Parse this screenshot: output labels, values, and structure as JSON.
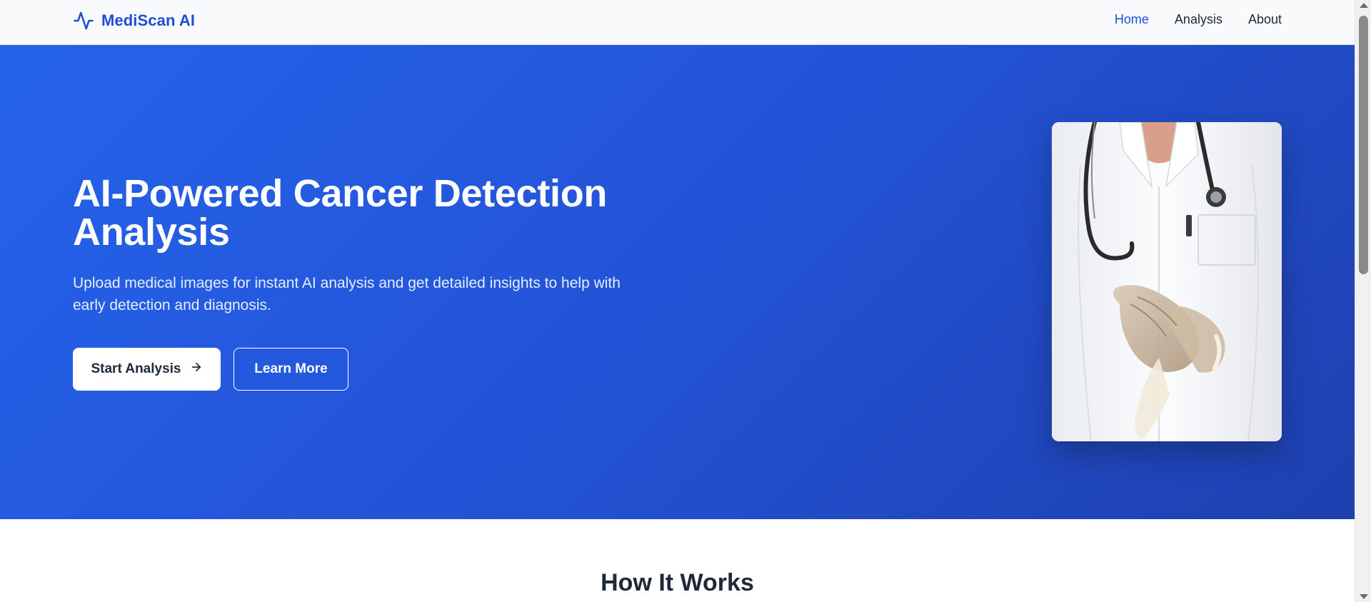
{
  "header": {
    "brand_name": "MediScan AI",
    "brand_icon": "activity-pulse-icon",
    "nav": [
      {
        "label": "Home",
        "active": true
      },
      {
        "label": "Analysis",
        "active": false
      },
      {
        "label": "About",
        "active": false
      }
    ]
  },
  "hero": {
    "title": "AI-Powered Cancer Detection Analysis",
    "subtitle": "Upload medical images for instant AI analysis and get detailed insights to help with early detection and diagnosis.",
    "primary_button": {
      "label": "Start Analysis",
      "icon": "arrow-right-icon"
    },
    "secondary_button": {
      "label": "Learn More"
    }
  },
  "section": {
    "title": "How It Works"
  },
  "colors": {
    "brand": "#1d4ed8",
    "hero_gradient_start": "#2563eb",
    "hero_gradient_end": "#1e40af",
    "text_dark": "#1f2937"
  }
}
